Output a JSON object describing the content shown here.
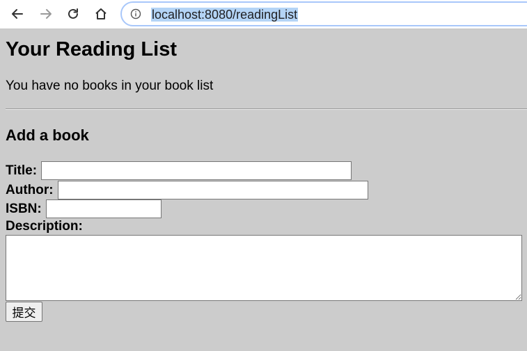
{
  "browser": {
    "url": "localhost:8080/readingList",
    "icons": {
      "back": "arrow-left-icon",
      "forward": "arrow-right-icon",
      "reload": "reload-icon",
      "home": "home-icon",
      "info": "info-circle-icon"
    }
  },
  "page": {
    "heading": "Your Reading List",
    "empty_message": "You have no books in your book list",
    "form": {
      "heading": "Add a book",
      "title_label": "Title:",
      "author_label": "Author:",
      "isbn_label": "ISBN:",
      "description_label": "Description:",
      "title_value": "",
      "author_value": "",
      "isbn_value": "",
      "description_value": "",
      "submit_label": "提交"
    }
  },
  "colors": {
    "page_background": "#cccccc",
    "url_highlight": "#b4d4f6",
    "address_bar_border": "#a8c7fa"
  }
}
